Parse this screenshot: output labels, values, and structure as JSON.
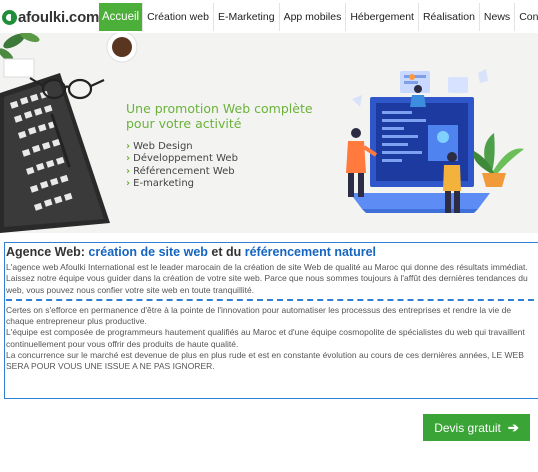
{
  "brand": {
    "logo_text": "afoulki",
    "logo_domain": ".com"
  },
  "nav": {
    "items": [
      {
        "label": "Accueil",
        "active": true
      },
      {
        "label": "Création web"
      },
      {
        "label": "E-Marketing"
      },
      {
        "label": "App mobiles"
      },
      {
        "label": "Hébergement"
      },
      {
        "label": "Réalisation"
      },
      {
        "label": "News"
      },
      {
        "label": "Contact"
      }
    ]
  },
  "hero": {
    "title_line1": "Une promotion Web complète",
    "title_line2": "pour votre activité",
    "services": [
      "Web Design",
      "Développement Web",
      "Référencement Web",
      "E-marketing"
    ]
  },
  "intro": {
    "heading_prefix": "Agence Web: ",
    "heading_link1": "création de site web",
    "heading_mid": " et du ",
    "heading_link2": "référencement naturel",
    "paragraph1": "L'agence web Afoulki International est le leader marocain de la création de site Web de qualité au Maroc qui donne des résultats immédiat. Laissez notre équipe vous guider dans la création de votre site web. Parce que nous sommes toujours à l'affût des dernières tendances du web, vous pouvez nous confier votre site web en toute tranquillité.",
    "paragraph2": "Certes on s'efforce en permanence d'être à la pointe de l'innovation pour automatiser les processus des entreprises et rendre la vie de chaque entrepreneur plus  productive.",
    "paragraph3": "L'équipe est composée de programmeurs hautement qualifiés au Maroc et d'une équipe cosmopolite de spécialistes du web qui travaillent continuellement pour vous offrir des produits de haute qualité.",
    "paragraph4": "La concurrence sur le marché est devenue de plus en plus rude et est en constante évolution au cours de ces dernières années, LE WEB SERA POUR VOUS UNE ISSUE A NE PAS IGNORER."
  },
  "cta": {
    "label": "Devis gratuit"
  },
  "colors": {
    "brand_green": "#4caf3a",
    "link_blue": "#1565c0",
    "border_blue": "#2f7fd6"
  }
}
